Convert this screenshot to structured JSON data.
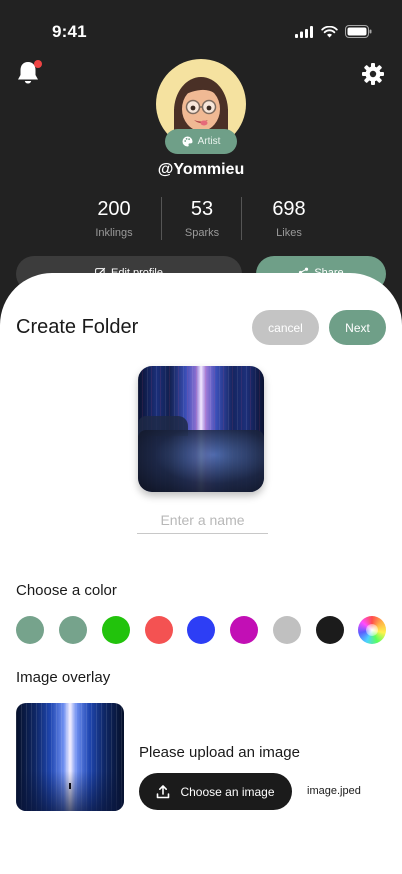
{
  "status_bar": {
    "time": "9:41"
  },
  "profile": {
    "badge": "Artist",
    "username": "@Yommieu",
    "stats": [
      {
        "value": "200",
        "label": "Inklings"
      },
      {
        "value": "53",
        "label": "Sparks"
      },
      {
        "value": "698",
        "label": "Likes"
      }
    ],
    "edit_label": "Edit profile",
    "share_label": "Share"
  },
  "sheet": {
    "title": "Create Folder",
    "cancel_label": "cancel",
    "next_label": "Next",
    "name_placeholder": "Enter a name",
    "color_title": "Choose a color",
    "colors": [
      "#76a38c",
      "#76a38c",
      "#22c30c",
      "#f45252",
      "#2d3ef5",
      "#c20fb5",
      "#c0c0c0",
      "#1b1b1b",
      "rainbow"
    ],
    "overlay_title": "Image overlay",
    "upload_prompt": "Please upload an image",
    "choose_label": "Choose an image",
    "file_name": "image.jped"
  },
  "colors": {
    "accent": "#6f9f88",
    "dark_bg": "#222222",
    "notification": "#ef4444"
  },
  "icons": [
    "bell-icon",
    "gear-icon",
    "palette-icon",
    "edit-icon",
    "share-icon",
    "upload-icon"
  ]
}
